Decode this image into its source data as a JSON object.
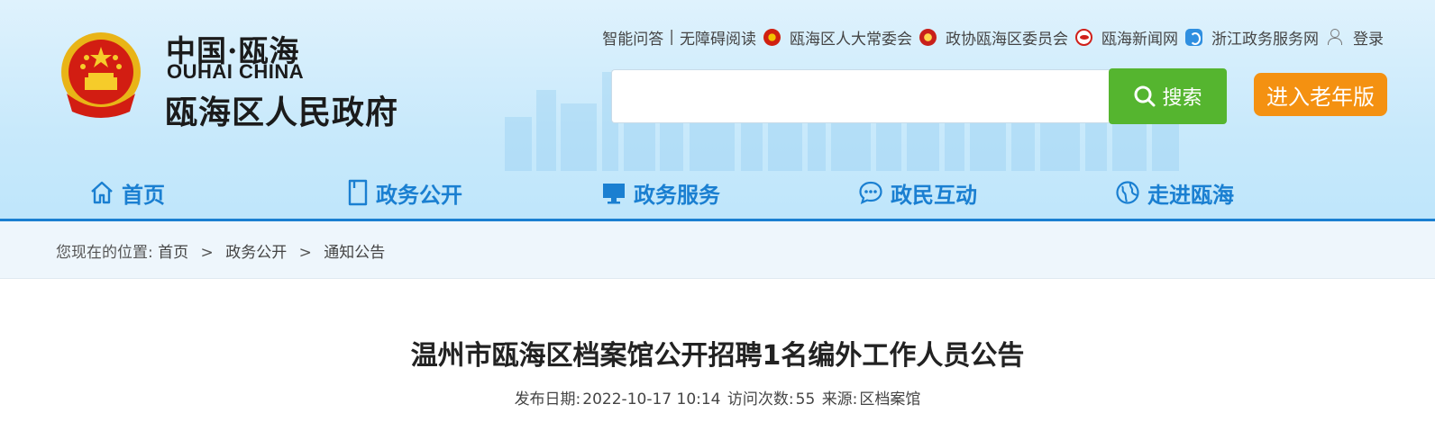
{
  "brand": {
    "top": "中国·瓯海",
    "english": "OUHAI CHINA",
    "name": "瓯海区人民政府"
  },
  "toplinks": {
    "smart_qa": "智能问答",
    "separator": "|",
    "accessible": "无障碍阅读",
    "npc": "瓯海区人大常委会",
    "cppcc": "政协瓯海区委员会",
    "news": "瓯海新闻网",
    "zj_service": "浙江政务服务网",
    "login": "登录"
  },
  "search": {
    "value": "",
    "placeholder": "",
    "button_label": "搜索"
  },
  "elder_mode": {
    "label": "进入老年版"
  },
  "nav": [
    {
      "label": "首页",
      "icon": "home-icon"
    },
    {
      "label": "政务公开",
      "icon": "document-icon"
    },
    {
      "label": "政务服务",
      "icon": "monitor-icon"
    },
    {
      "label": "政民互动",
      "icon": "chat-icon"
    },
    {
      "label": "走进瓯海",
      "icon": "globe-icon"
    }
  ],
  "breadcrumb": {
    "prefix": "您现在的位置:",
    "items": [
      "首页",
      "政务公开",
      "通知公告"
    ],
    "separator": ">"
  },
  "article": {
    "title": "温州市瓯海区档案馆公开招聘1名编外工作人员公告",
    "date_label": "发布日期:",
    "date": "2022-10-17 10:14",
    "visits_label": "访问次数:",
    "visits": "55",
    "source_label": "来源:",
    "source": "区档案馆"
  },
  "colors": {
    "accent": "#1a7fd1",
    "search_button": "#55b52f",
    "elder_button": "#f49111"
  }
}
